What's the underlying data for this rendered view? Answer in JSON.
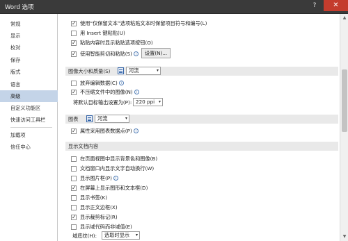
{
  "window": {
    "title": "Word 选项",
    "help": "?",
    "close": "✕"
  },
  "sidebar": {
    "items": [
      {
        "label": "常规"
      },
      {
        "label": "显示"
      },
      {
        "label": "校对"
      },
      {
        "label": "保存"
      },
      {
        "label": "版式"
      },
      {
        "label": "语言"
      },
      {
        "label": "高级",
        "active": true
      },
      {
        "label": "自定义功能区"
      },
      {
        "label": "快速访问工具栏"
      },
      {
        "label": "加载项"
      },
      {
        "label": "信任中心"
      }
    ]
  },
  "top_options": [
    {
      "label": "使用“仅保留文本”选项粘贴文本时保留项目符号和编号(L)",
      "checked": true
    },
    {
      "label": "用 Insert 键粘贴(U)",
      "checked": false
    },
    {
      "label": "粘贴内容时显示粘贴选项按钮(O)",
      "checked": true
    },
    {
      "label": "使用智能剪切和粘贴(S)",
      "checked": true,
      "info": true
    }
  ],
  "settings_button": "设置(N)...",
  "image_section": {
    "title": "图像大小和质量(S)",
    "doc_select": "河流",
    "options": [
      {
        "label": "放弃编辑数据(C)",
        "checked": false,
        "info": true
      },
      {
        "label": "不压缩文件中的图像(N)",
        "checked": true,
        "info": true
      }
    ],
    "default_output_label": "将默认目标输出设置为(P):",
    "default_output_value": "220 ppi"
  },
  "chart_section": {
    "title": "图表",
    "doc_select": "河流",
    "options": [
      {
        "label": "属性采用图表数据点(P)",
        "checked": true,
        "info": true
      }
    ]
  },
  "display_section": {
    "title": "显示文档内容",
    "options": [
      {
        "label": "在页面视图中显示背景色和图像(B)",
        "checked": false
      },
      {
        "label": "文档窗口内显示文字自动换行(W)",
        "checked": false
      },
      {
        "label": "显示图片框(P)",
        "checked": false,
        "info": true
      },
      {
        "label": "在屏幕上显示图形和文本框(D)",
        "checked": true
      },
      {
        "label": "显示书签(K)",
        "checked": false
      },
      {
        "label": "显示正文边框(X)",
        "checked": false
      },
      {
        "label": "显示裁剪标记(R)",
        "checked": true
      },
      {
        "label": "显示域代码而非域值(E)",
        "checked": false
      }
    ],
    "shading_label": "域底纹(H):",
    "shading_value": "选取时显示"
  },
  "icons": {
    "info": "i",
    "dropdown": "▾",
    "scroll_up": "▲",
    "scroll_down": "▼"
  }
}
